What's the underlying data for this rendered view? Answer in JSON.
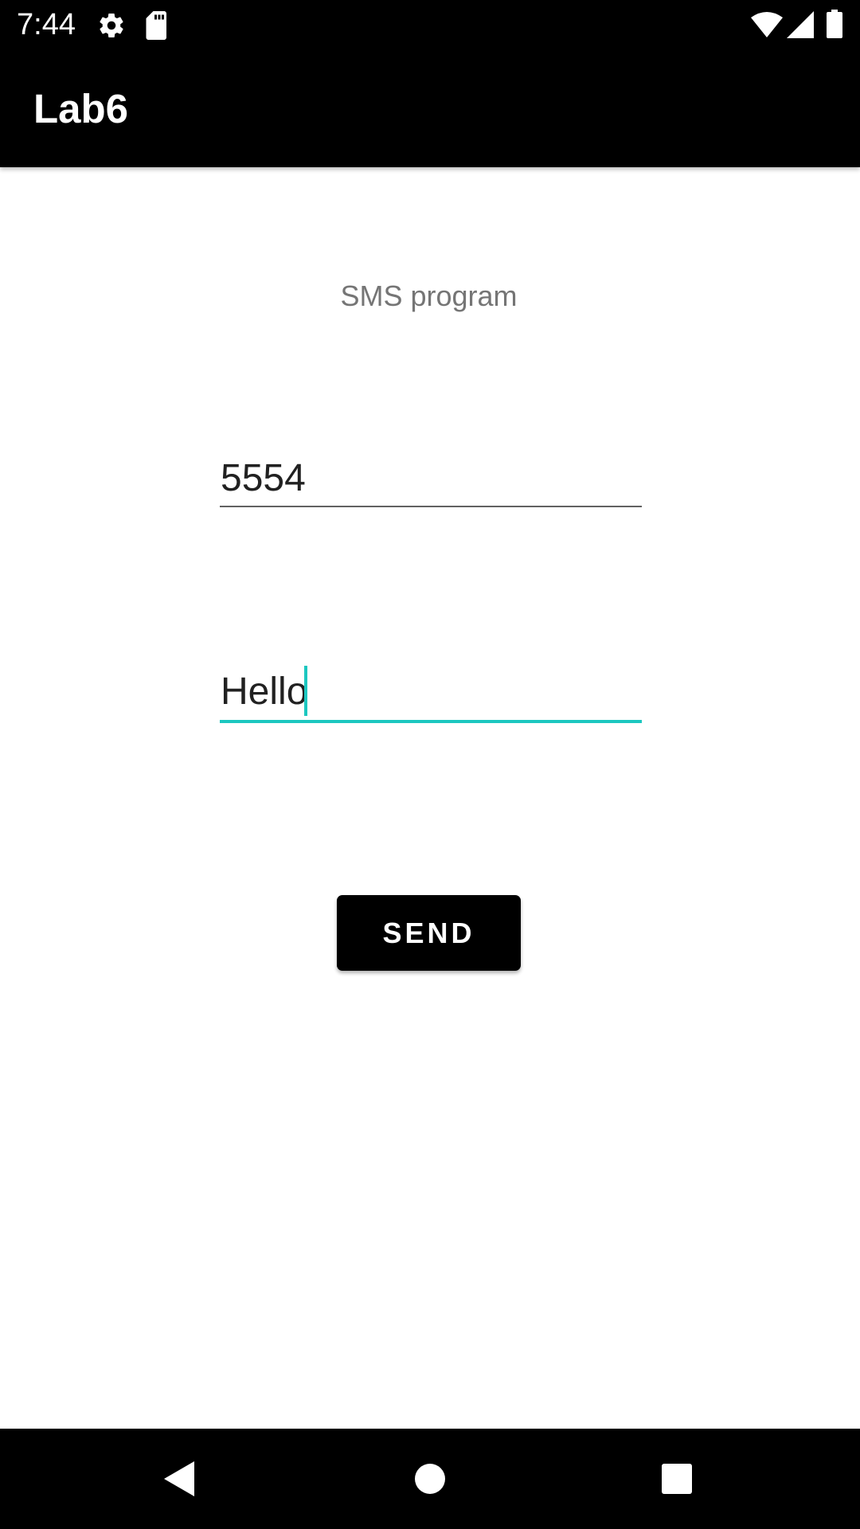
{
  "status_bar": {
    "time": "7:44",
    "icons": [
      "gear-icon",
      "sd-card-icon",
      "wifi-icon",
      "signal-icon",
      "battery-icon"
    ]
  },
  "app_bar": {
    "title": "Lab6"
  },
  "main": {
    "label": "SMS program",
    "phone_field": {
      "value": "5554"
    },
    "message_field": {
      "value": "Hello",
      "focused": true
    },
    "send_button_label": "SEND"
  },
  "nav_bar": {
    "icons": [
      "back-icon",
      "home-icon",
      "recents-icon"
    ]
  },
  "colors": {
    "accent": "#1cc7c0",
    "bar_background": "#000000",
    "label_text": "#757575"
  }
}
